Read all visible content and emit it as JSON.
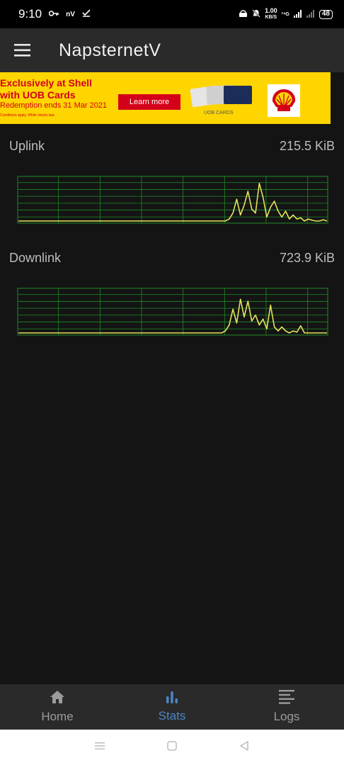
{
  "status_bar": {
    "time": "9:10",
    "icons_left": "nV",
    "speed_value": "1.00",
    "speed_unit": "KB/S",
    "network": "²⁴G",
    "battery": "48"
  },
  "app_bar": {
    "title": "NapsternetV"
  },
  "ad": {
    "headline_line1": "Exclusively at Shell",
    "headline_line2": "with UOB Cards",
    "subline": "Redemption ends 31 Mar 2021",
    "fine_print": "Conditions apply. While stocks last.",
    "cta": "Learn more",
    "cards_label": "UOB CARDS"
  },
  "stats": {
    "uplink": {
      "label": "Uplink",
      "value": "215.5 KiB"
    },
    "downlink": {
      "label": "Downlink",
      "value": "723.9 KiB"
    }
  },
  "chart_data": [
    {
      "type": "line",
      "series": [
        {
          "values": [
            0,
            0,
            0,
            0,
            0,
            0,
            0,
            0,
            0,
            0,
            0,
            0,
            0,
            0,
            0,
            0,
            0,
            0,
            0,
            0,
            0,
            0,
            0,
            0,
            0,
            0,
            0,
            0,
            0,
            0,
            0,
            0,
            0,
            0,
            0,
            0,
            0,
            0,
            0,
            0,
            0,
            0,
            0,
            0,
            0,
            0,
            0,
            0,
            0,
            0,
            0,
            0,
            0,
            0,
            0,
            0,
            0.05,
            0.2,
            0.55,
            0.15,
            0.4,
            0.75,
            0.3,
            0.2,
            0.95,
            0.6,
            0.1,
            0.35,
            0.5,
            0.25,
            0.1,
            0.25,
            0.05,
            0.15,
            0.05,
            0.08,
            0,
            0.05,
            0.02,
            0,
            0,
            0.03,
            0
          ]
        }
      ],
      "grid": true,
      "colors": {
        "line": "#e6e25c",
        "grid": "#1f8a2a"
      }
    },
    {
      "type": "line",
      "series": [
        {
          "values": [
            0,
            0,
            0,
            0,
            0,
            0,
            0,
            0,
            0,
            0,
            0,
            0,
            0,
            0,
            0,
            0,
            0,
            0,
            0,
            0,
            0,
            0,
            0,
            0,
            0,
            0,
            0,
            0,
            0,
            0,
            0,
            0,
            0,
            0,
            0,
            0,
            0,
            0,
            0,
            0,
            0,
            0,
            0,
            0,
            0,
            0,
            0,
            0,
            0,
            0,
            0,
            0,
            0,
            0,
            0,
            0.05,
            0.2,
            0.6,
            0.25,
            0.85,
            0.4,
            0.8,
            0.3,
            0.45,
            0.2,
            0.35,
            0.1,
            0.7,
            0.15,
            0.05,
            0.15,
            0.05,
            0,
            0.05,
            0.02,
            0.18,
            0,
            0,
            0,
            0,
            0,
            0,
            0
          ]
        }
      ],
      "grid": true,
      "colors": {
        "line": "#e6e25c",
        "grid": "#1f8a2a"
      }
    }
  ],
  "bottom_nav": {
    "home": "Home",
    "stats": "Stats",
    "logs": "Logs"
  },
  "colors": {
    "accent": "#4c86c6",
    "ad_bg": "#ffd500",
    "ad_red": "#d4001a"
  }
}
